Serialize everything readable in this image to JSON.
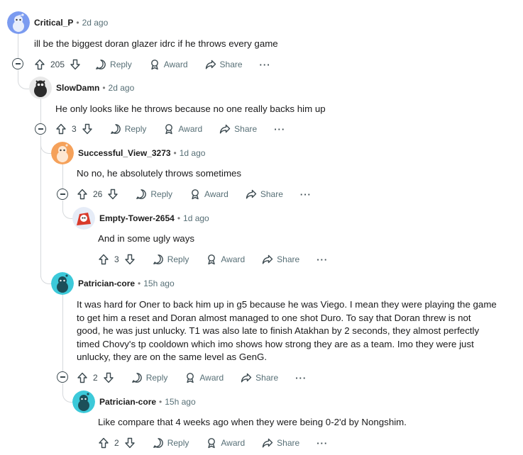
{
  "comments": [
    {
      "username": "Critical_P",
      "time": "2d ago",
      "lines": [
        "ill be the biggest doran glazer idrc if he throws every game"
      ],
      "votes": "205",
      "avatar_color": "#7b9bf0"
    },
    {
      "username": "SlowDamn",
      "time": "2d ago",
      "lines": [
        "He only looks like he throws because no one really backs him up"
      ],
      "votes": "3",
      "avatar_color": "#2b2b2b"
    },
    {
      "username": "Successful_View_3273",
      "time": "1d ago",
      "lines": [
        "No no, he absolutely throws sometimes"
      ],
      "votes": "26",
      "avatar_color": "#f5a15a"
    },
    {
      "username": "Empty-Tower-2654",
      "time": "1d ago",
      "lines": [
        "And in some ugly ways"
      ],
      "votes": "3",
      "avatar_color": "#d93a2b"
    },
    {
      "username": "Patrician-core",
      "time": "15h ago",
      "lines": [
        "It was hard for Oner to back him up in g5 because he was Viego. I mean they were playing the game",
        "to get him a reset and Doran almost managed to one shot Duro. To say that Doran threw is not",
        "good, he was just unlucky. T1 was also late to finish Atakhan by 2 seconds, they almost perfectly",
        "timed Chovy's tp cooldown which imo shows how strong they are as a team. Imo they were just",
        "unlucky, they are on the same level as GenG."
      ],
      "votes": "2",
      "avatar_color": "#3cc9d9"
    },
    {
      "username": "Patrician-core",
      "time": "15h ago",
      "lines": [
        "Like compare that 4 weeks ago when they were being 0-2'd by Nongshim."
      ],
      "votes": "2",
      "avatar_color": "#3cc9d9"
    }
  ],
  "actions": {
    "reply": "Reply",
    "award": "Award",
    "share": "Share",
    "more": "···",
    "separator": "•"
  }
}
